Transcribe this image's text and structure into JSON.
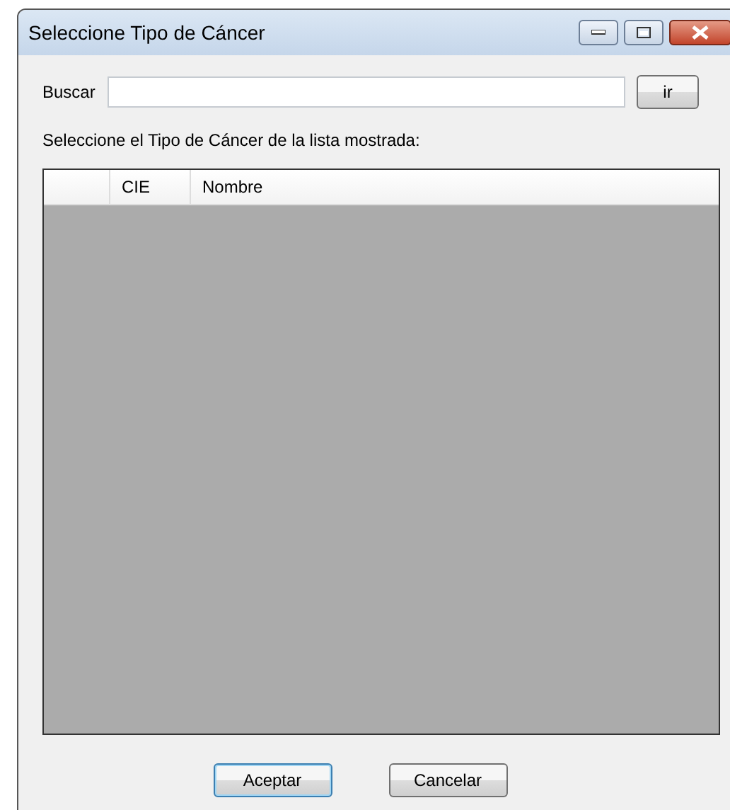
{
  "window": {
    "title": "Seleccione Tipo de Cáncer"
  },
  "search": {
    "label": "Buscar",
    "button": "ir"
  },
  "instruction": "Seleccione el Tipo de Cáncer de la lista mostrada:",
  "table": {
    "columns": [
      "CIE",
      "Nombre"
    ]
  },
  "buttons": [
    {
      "label": "Aceptar",
      "default": true
    },
    {
      "label": "Cancelar",
      "default": false
    }
  ]
}
